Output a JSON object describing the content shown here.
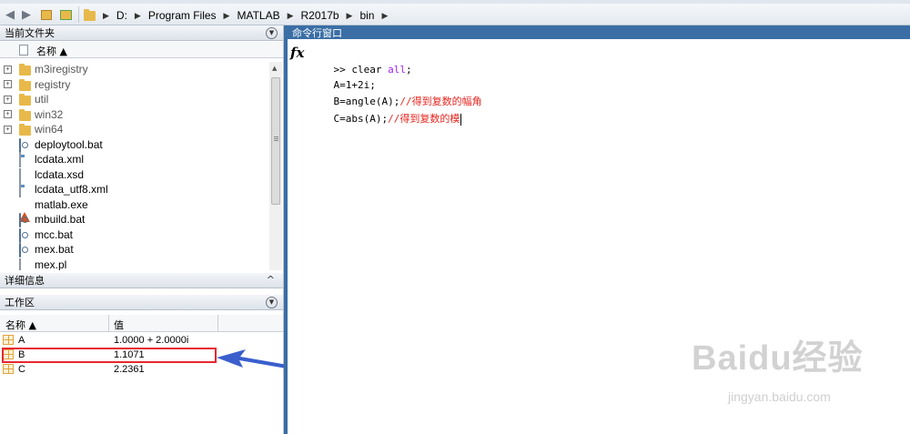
{
  "address_bar": {
    "path": [
      "D:",
      "Program Files",
      "MATLAB",
      "R2017b",
      "bin"
    ]
  },
  "current_folder": {
    "title": "当前文件夹",
    "column_name": "名称 ▲",
    "items": [
      {
        "name": "m3iregistry",
        "type": "folder",
        "expandable": true
      },
      {
        "name": "registry",
        "type": "folder",
        "expandable": true
      },
      {
        "name": "util",
        "type": "folder",
        "expandable": true
      },
      {
        "name": "win32",
        "type": "folder",
        "expandable": true
      },
      {
        "name": "win64",
        "type": "folder",
        "expandable": true
      },
      {
        "name": "deploytool.bat",
        "type": "bat"
      },
      {
        "name": "lcdata.xml",
        "type": "xml"
      },
      {
        "name": "lcdata.xsd",
        "type": "doc"
      },
      {
        "name": "lcdata_utf8.xml",
        "type": "xml"
      },
      {
        "name": "matlab.exe",
        "type": "matlab"
      },
      {
        "name": "mbuild.bat",
        "type": "bat"
      },
      {
        "name": "mcc.bat",
        "type": "bat"
      },
      {
        "name": "mex.bat",
        "type": "bat"
      },
      {
        "name": "mex.pl",
        "type": "doc"
      }
    ]
  },
  "details": {
    "title": "详细信息",
    "toggle": "^"
  },
  "workspace": {
    "title": "工作区",
    "col_name": "名称 ▲",
    "col_value": "值",
    "variables": [
      {
        "name": "A",
        "value": "1.0000 + 2.0000i"
      },
      {
        "name": "B",
        "value": "1.1071"
      },
      {
        "name": "C",
        "value": "2.2361"
      }
    ],
    "highlighted": "B",
    "highlight_color": "#e8262f"
  },
  "command_window": {
    "title": "命令行窗口",
    "fx": "fx",
    "prompt": ">>",
    "lines": [
      {
        "plain": "clear",
        "keyword": " all",
        "tail": ";",
        "comment": ""
      },
      {
        "plain": "A=1+2i;",
        "keyword": "",
        "tail": "",
        "comment": ""
      },
      {
        "plain": "B=angle(A);",
        "keyword": "",
        "tail": "",
        "comment": "//得到复数的幅角"
      },
      {
        "plain": "C=abs(A);",
        "keyword": "",
        "tail": "",
        "comment": "//得到复数的模"
      }
    ]
  },
  "colors": {
    "title_bar": "#3a6ea5",
    "arrow": "#3a5fcd",
    "keyword": "#a020f0",
    "comment": "#e8261f"
  },
  "watermark": {
    "brand": "Baidu经验",
    "url": "jingyan.baidu.com"
  }
}
